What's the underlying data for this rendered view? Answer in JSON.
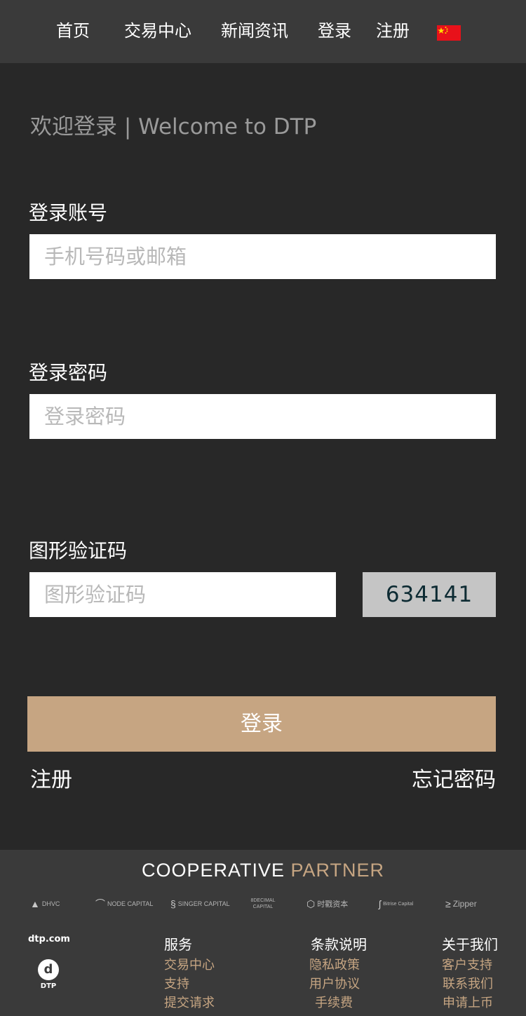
{
  "nav": {
    "items": [
      "首页",
      "交易中心",
      "新闻资讯",
      "登录",
      "注册"
    ],
    "flag_icon": "china-flag-icon"
  },
  "login": {
    "welcome": "欢迎登录 | Welcome to DTP",
    "account_label": "登录账号",
    "account_placeholder": "手机号码或邮箱",
    "password_label": "登录密码",
    "password_placeholder": "登录密码",
    "captcha_label": "图形验证码",
    "captcha_placeholder": "图形验证码",
    "captcha_code": "634141",
    "submit": "登录",
    "register_link": "注册",
    "forgot_link": "忘记密码"
  },
  "footer": {
    "coop_title_1": "COOPERATIVE",
    "coop_title_2": "PARTNER",
    "partners": [
      "DHVC",
      "NODE CAPITAL",
      "SINGER CAPITAL",
      "8DECIMAL CAPITAL",
      "时戳资本",
      "Bitrise Capital",
      "Zipper"
    ],
    "site": "dtp.com",
    "logo_text": "DTP",
    "columns": [
      {
        "title": "服务",
        "links": [
          "交易中心",
          "支持",
          "提交请求"
        ]
      },
      {
        "title": "条款说明",
        "links": [
          "隐私政策",
          "用户协议",
          "手续费"
        ]
      },
      {
        "title": "关于我们",
        "links": [
          "客户支持",
          "联系我们",
          "申请上币"
        ]
      }
    ]
  },
  "colors": {
    "background": "#282828",
    "header_bg": "#3a3a3a",
    "accent": "#c6a582",
    "captcha_bg": "#c5c5c5"
  }
}
